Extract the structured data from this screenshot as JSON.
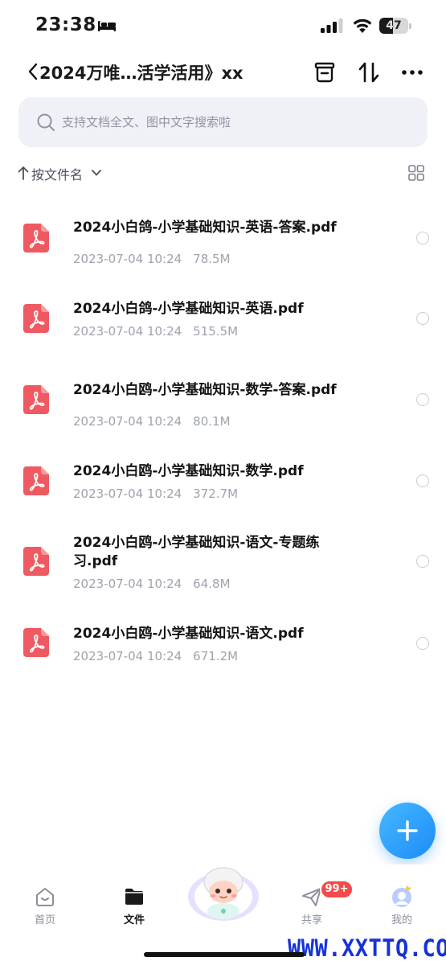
{
  "status_bar": {
    "time": "23:38",
    "battery": "47",
    "battery_level": 0.47
  },
  "nav": {
    "title": "2024万唯…活学活用》xx"
  },
  "search": {
    "placeholder": "支持文档全文、图中文字搜索啦"
  },
  "sort": {
    "label": "按文件名"
  },
  "files": [
    {
      "name": "2024小白鸽-小学基础知识-英语-答案.pdf",
      "date": "2023-07-04 10:24",
      "size": "78.5M"
    },
    {
      "name": "2024小白鸽-小学基础知识-英语.pdf",
      "date": "2023-07-04 10:24",
      "size": "515.5M"
    },
    {
      "name": "2024小白鸥-小学基础知识-数学-答案.pdf",
      "date": "2023-07-04 10:24",
      "size": "80.1M"
    },
    {
      "name": "2024小白鸥-小学基础知识-数学.pdf",
      "date": "2023-07-04 10:24",
      "size": "372.7M"
    },
    {
      "name": "2024小白鸥-小学基础知识-语文-专题练习.pdf",
      "date": "2023-07-04 10:24",
      "size": "64.8M"
    },
    {
      "name": "2024小白鸥-小学基础知识-语文.pdf",
      "date": "2023-07-04 10:24",
      "size": "671.2M"
    }
  ],
  "tabbar": {
    "home": "首页",
    "files": "文件",
    "share": "共享",
    "mine": "我的",
    "share_badge": "99+"
  },
  "watermark": "WWW.XXTTQ.COM",
  "colors": {
    "accent": "#1d8cf8",
    "pdf": "#ef5a62",
    "badge": "#f24b4b"
  }
}
